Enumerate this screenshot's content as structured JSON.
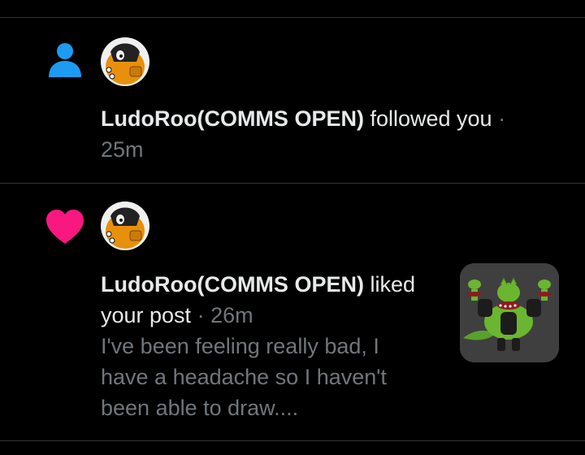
{
  "colors": {
    "background": "#000000",
    "divider": "#2f3336",
    "primary_text": "#e7e9ea",
    "secondary_text": "#71767b",
    "follow_icon": "#1d9bf0",
    "like_icon": "#f91880"
  },
  "notifications": [
    {
      "type": "follow",
      "icon": "person-icon",
      "user_name": "LudoRoo(COMMS OPEN)",
      "action": "followed you",
      "separator": "·",
      "time": "25m"
    },
    {
      "type": "like",
      "icon": "heart-icon",
      "user_name": "LudoRoo(COMMS OPEN)",
      "action_line1": "liked",
      "action_line2": "your post",
      "separator": "·",
      "time": "26m",
      "post_preview_lines": [
        "I've been feeling really bad, I",
        "have a headache so I haven't",
        "been able to draw...."
      ]
    }
  ]
}
